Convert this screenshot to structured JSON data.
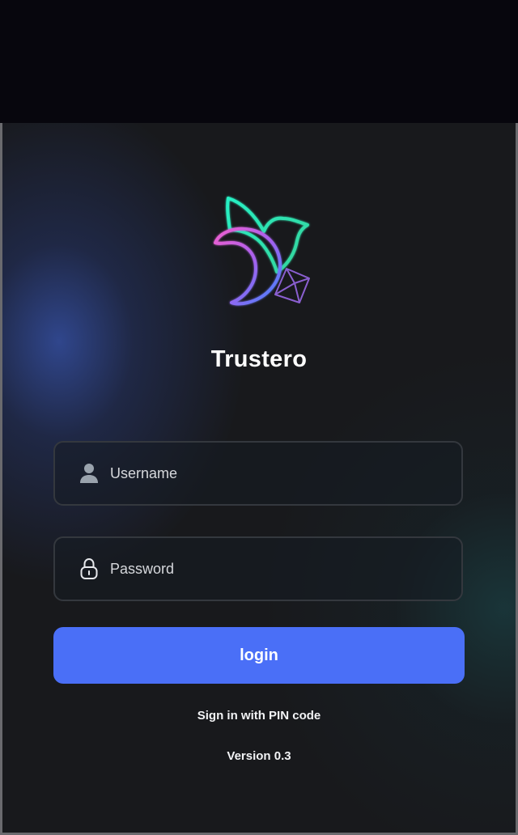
{
  "app": {
    "title": "Trustero"
  },
  "form": {
    "username": {
      "placeholder": "Username",
      "value": "",
      "icon": "user-icon"
    },
    "password": {
      "placeholder": "Password",
      "value": "",
      "icon": "lock-icon"
    },
    "login_label": "login",
    "pin_link_label": "Sign in with PIN code"
  },
  "footer": {
    "version": "Version 0.3"
  },
  "colors": {
    "accent": "#4a6ff7",
    "background": "#18191c",
    "logo_teal": "#2de8c0",
    "logo_pink": "#e05ad8",
    "logo_blue": "#4a7cff"
  }
}
